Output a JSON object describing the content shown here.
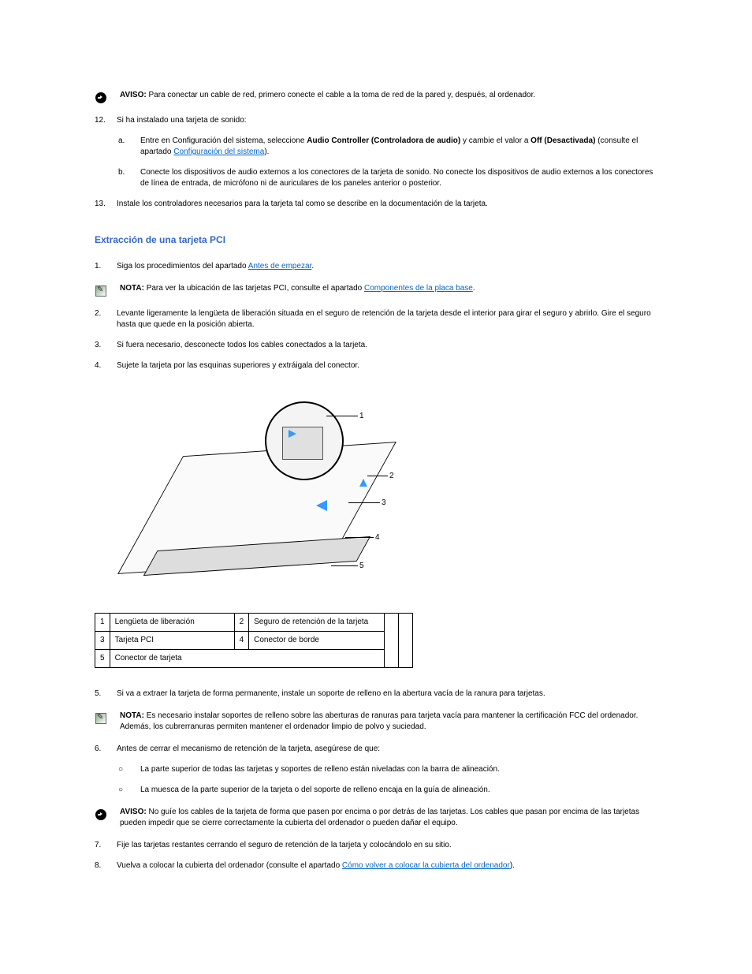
{
  "aviso_label": "AVISO:",
  "aviso1_text": "Para conectar un cable de red, primero conecte el cable a la toma de red de la pared y, después, al ordenador.",
  "step12": {
    "num": "12.",
    "body_a": "Si ha instalado una tarjeta de sonido:",
    "a": {
      "num": "a.",
      "body_pre": "Entre en Configuración del sistema, seleccione ",
      "body_mid": "Audio Controller (Controladora de audio)",
      "body_post": " y cambie el valor a ",
      "body_off": "Off (Desactivada)",
      "body_tail": " (consulte el apartado ",
      "link": "Configuración del sistema",
      "body_close": ")."
    },
    "b": {
      "num": "b.",
      "body": "Conecte los dispositivos de audio externos a los conectores de la tarjeta de sonido. No conecte los dispositivos de audio externos a los conectores de línea de entrada, de micrófono ni de auriculares de los paneles anterior o posterior."
    }
  },
  "step13": {
    "num": "13.",
    "body": "Instale los controladores necesarios para la tarjeta tal como se describe en la documentación de la tarjeta."
  },
  "section_heading": "Extracción de una tarjeta PCI",
  "step1": {
    "num": "1.",
    "body_pre": "Siga los procedimientos del apartado ",
    "link": "Antes de empezar",
    "body_post": "."
  },
  "nota_label": "NOTA:",
  "nota1_pre": "Para ver la ubicación de las tarjetas PCI, consulte el apartado ",
  "nota1_link": "Componentes de la placa base",
  "nota1_post": ".",
  "step2": {
    "num": "2.",
    "body": "Levante ligeramente la lengüeta de liberación situada en el seguro de retención de la tarjeta desde el interior para girar el seguro y abrirlo. Gire el seguro hasta que quede en la posición abierta."
  },
  "step3": {
    "num": "3.",
    "body": "Si fuera necesario, desconecte todos los cables conectados a la tarjeta."
  },
  "step4": {
    "num": "4.",
    "body": "Sujete la tarjeta por las esquinas superiores y extráigala del conector."
  },
  "legend": {
    "r1c1": "1",
    "r1c2": "Lengüeta de liberación",
    "r1c3": "2",
    "r1c4": "Seguro de retención de la tarjeta",
    "r2c1": "3",
    "r2c2": "Tarjeta PCI",
    "r2c3": "4",
    "r2c4": "Conector de borde",
    "r3c1": "5",
    "r3c2": "Conector de tarjeta"
  },
  "step5": {
    "num": "5.",
    "body": "Si va a extraer la tarjeta de forma permanente, instale un soporte de relleno en la abertura vacía de la ranura para tarjetas."
  },
  "nota2_body": "Es necesario instalar soportes de relleno sobre las aberturas de ranuras para tarjeta vacía para mantener la certificación FCC del ordenador. Además, los cubrerranuras permiten mantener el ordenador limpio de polvo y suciedad.",
  "step6": {
    "num": "6.",
    "body": "Antes de cerrar el mecanismo de retención de la tarjeta, asegúrese de que:",
    "sub1": "La parte superior de todas las tarjetas y soportes de relleno están niveladas con la barra de alineación.",
    "sub2": "La muesca de la parte superior de la tarjeta o del soporte de relleno encaja en la guía de alineación."
  },
  "aviso2_pre": "No guíe los cables de la tarjeta de forma que pasen por encima o por detrás de las tarjetas. Los cables que pasan por encima de las tarjetas pueden impedir que se cierre ",
  "aviso2_post": "correctamente la cubierta del ordenador o pueden dañar el equipo.",
  "step7": {
    "num": "7.",
    "body": "Fije las tarjetas restantes cerrando el seguro de retención de la tarjeta y colocándolo en su sitio."
  },
  "step8": {
    "num": "8.",
    "body_pre": "Vuelva a colocar la cubierta del ordenador (consulte el apartado ",
    "link": "Cómo volver a colocar la cubierta del ordenador",
    "body_post": ")."
  }
}
